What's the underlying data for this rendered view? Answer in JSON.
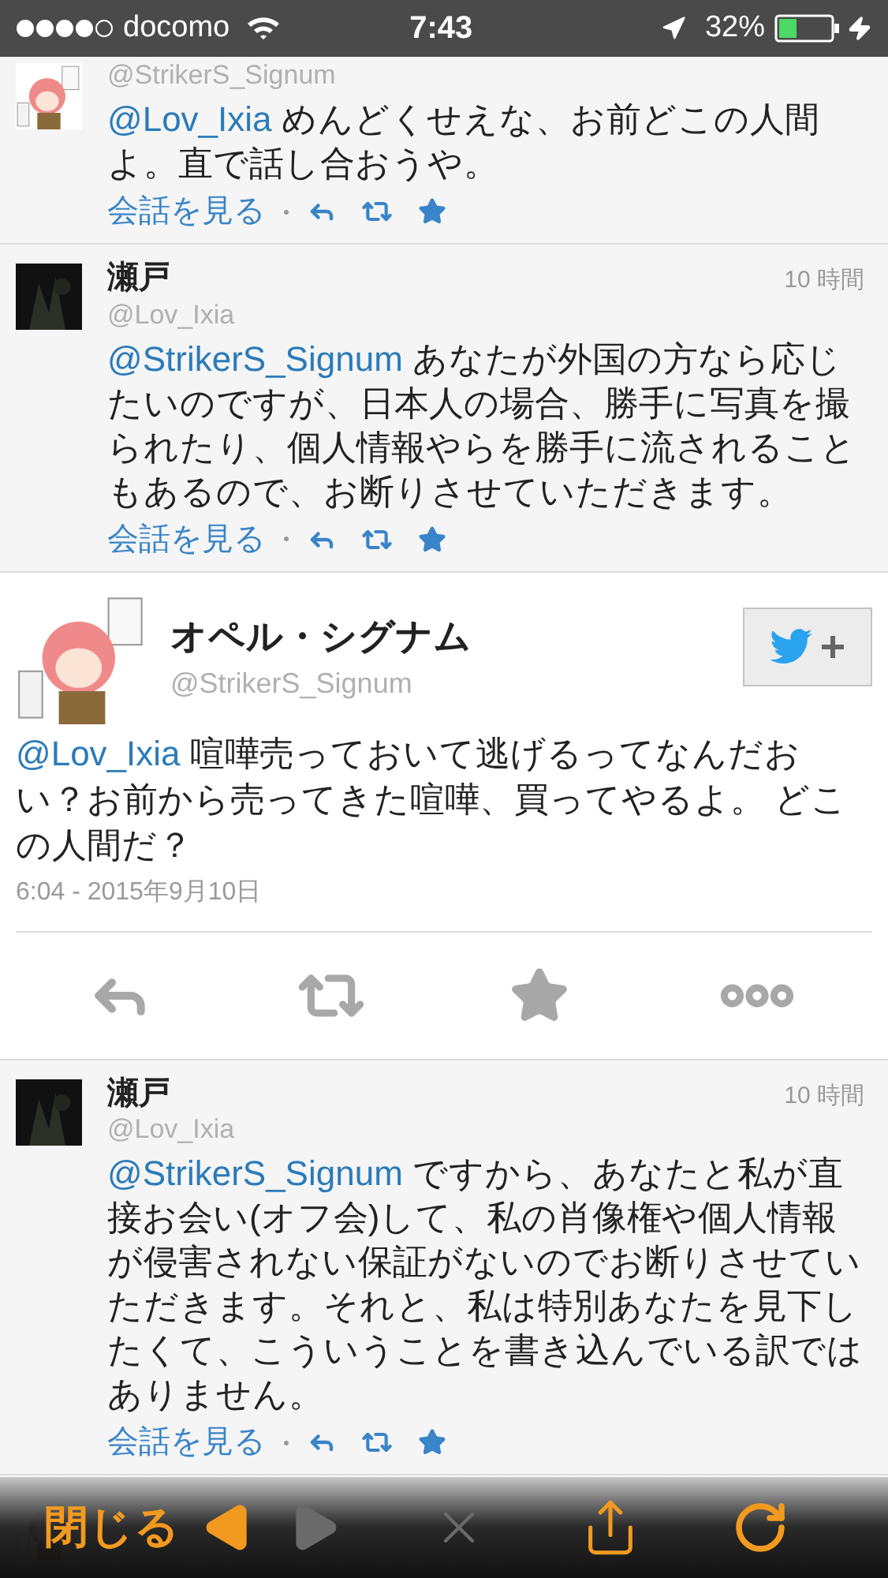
{
  "status_bar": {
    "carrier": "docomo",
    "time": "7:43",
    "battery": "32%"
  },
  "tweets": [
    {
      "kind": "reply",
      "handle": "@StrikerS_Signum",
      "mention": "@Lov_Ixia",
      "text": "めんどくせえな、お前どこの人間よ。直で話し合おうや。",
      "link": "会話を見る"
    },
    {
      "kind": "reply",
      "name": "瀬戸",
      "time": "10 時間",
      "handle": "@Lov_Ixia",
      "mention": "@StrikerS_Signum",
      "text": "あなたが外国の方なら応じたいのですが、日本人の場合、勝手に写真を撮られたり、個人情報やらを勝手に流されることもあるので、お断りさせていただきます。",
      "link": "会話を見る"
    },
    {
      "kind": "detail",
      "name": "オペル・シグナム",
      "handle": "@StrikerS_Signum",
      "mention": "@Lov_Ixia",
      "text": "喧嘩売っておいて逃げるってなんだおい？お前から売ってきた喧嘩、買ってやるよ。 どこの人間だ？",
      "date": "6:04 - 2015年9月10日"
    },
    {
      "kind": "reply",
      "name": "瀬戸",
      "time": "10 時間",
      "handle": "@Lov_Ixia",
      "mention": "@StrikerS_Signum",
      "text": "ですから、あなたと私が直接お会い(オフ会)して、私の肖像権や個人情報が侵害されない保証がないのでお断りさせていただきます。それと、私は特別あなたを見下したくて、こういうことを書き込んでいる訳ではありません。",
      "link": "会話を見る"
    },
    {
      "kind": "peek"
    }
  ],
  "toolbar": {
    "close": "閉じる",
    "back_disabled": false,
    "forward_disabled": true,
    "stop_disabled": true
  }
}
